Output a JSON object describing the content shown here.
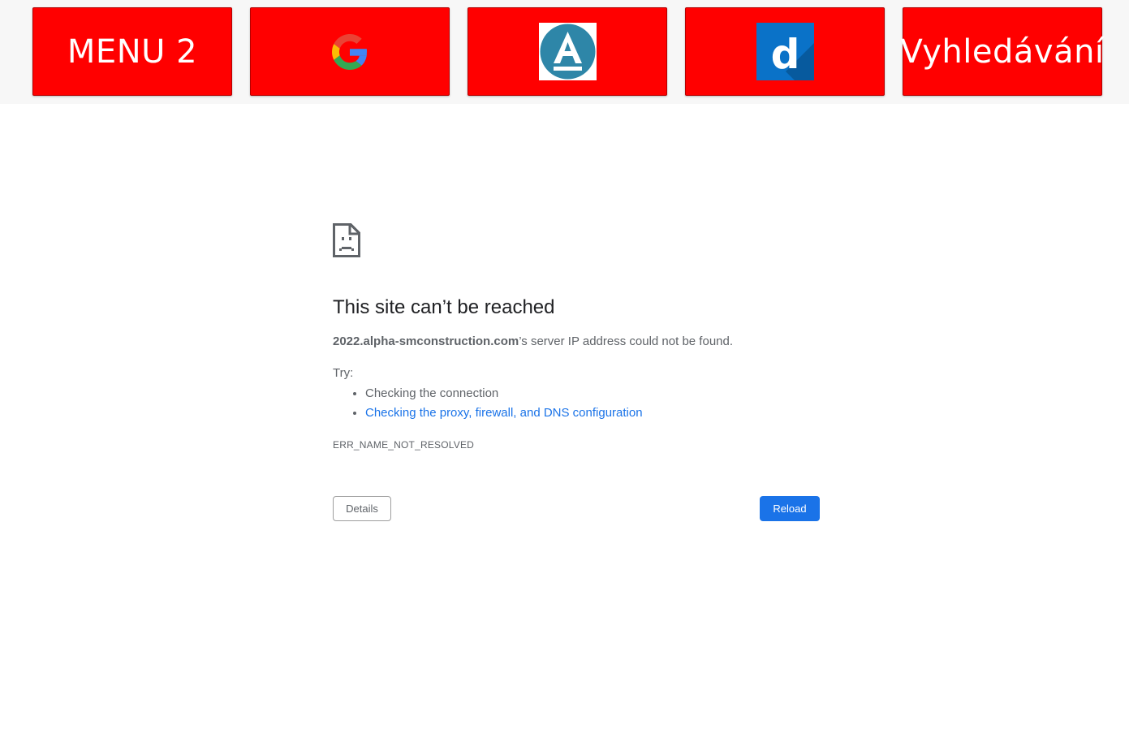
{
  "toolbar": {
    "tiles": [
      {
        "label": "MENU 2"
      },
      {
        "icon": "google-icon"
      },
      {
        "icon": "a-circle-logo-icon",
        "letter": "A"
      },
      {
        "icon": "d-logo-icon",
        "letter": "d"
      },
      {
        "label": "Vyhledávání"
      }
    ],
    "tile_color": "#ff0000"
  },
  "error": {
    "icon": "sad-document-icon",
    "title": "This site can’t be reached",
    "host": "2022.alpha-smconstruction.com",
    "description_suffix": "’s server IP address could not be found.",
    "try_label": "Try:",
    "suggestions": [
      {
        "text": "Checking the connection"
      },
      {
        "text": "Checking the proxy, firewall, and DNS configuration"
      }
    ],
    "code": "ERR_NAME_NOT_RESOLVED",
    "details_label": "Details",
    "reload_label": "Reload",
    "link_color": "#1a73e8",
    "button_color": "#1a73e8"
  }
}
